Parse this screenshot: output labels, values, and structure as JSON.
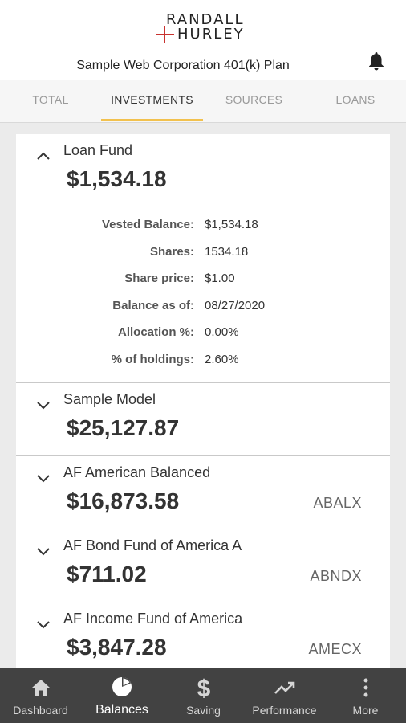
{
  "header": {
    "logo_line1": "RANDALL",
    "logo_line2": "HURLEY",
    "plan_title": "Sample Web Corporation 401(k) Plan"
  },
  "tabs": [
    {
      "label": "TOTAL",
      "active": false
    },
    {
      "label": "INVESTMENTS",
      "active": true
    },
    {
      "label": "SOURCES",
      "active": false
    },
    {
      "label": "LOANS",
      "active": false
    }
  ],
  "funds": [
    {
      "name": "Loan Fund",
      "amount": "$1,534.18",
      "ticker": "",
      "expanded": true,
      "details": [
        {
          "label": "Vested Balance:",
          "value": "$1,534.18"
        },
        {
          "label": "Shares:",
          "value": "1534.18"
        },
        {
          "label": "Share price:",
          "value": "$1.00"
        },
        {
          "label": "Balance as of:",
          "value": "08/27/2020"
        },
        {
          "label": "Allocation %:",
          "value": "0.00%"
        },
        {
          "label": "% of holdings:",
          "value": "2.60%"
        }
      ]
    },
    {
      "name": "Sample Model",
      "amount": "$25,127.87",
      "ticker": "",
      "expanded": false
    },
    {
      "name": "AF American Balanced",
      "amount": "$16,873.58",
      "ticker": "ABALX",
      "expanded": false
    },
    {
      "name": "AF Bond Fund of America A",
      "amount": "$711.02",
      "ticker": "ABNDX",
      "expanded": false
    },
    {
      "name": "AF Income Fund of America",
      "amount": "$3,847.28",
      "ticker": "AMECX",
      "expanded": false
    }
  ],
  "bottom_nav": [
    {
      "label": "Dashboard",
      "icon": "home-icon",
      "active": false
    },
    {
      "label": "Balances",
      "icon": "pie-chart-icon",
      "active": true
    },
    {
      "label": "Saving",
      "icon": "dollar-icon",
      "active": false
    },
    {
      "label": "Performance",
      "icon": "trending-up-icon",
      "active": false
    },
    {
      "label": "More",
      "icon": "more-vertical-icon",
      "active": false
    }
  ],
  "colors": {
    "accent": "#f2c14e",
    "logo_cross": "#c8322f",
    "nav_bg": "#424242"
  }
}
